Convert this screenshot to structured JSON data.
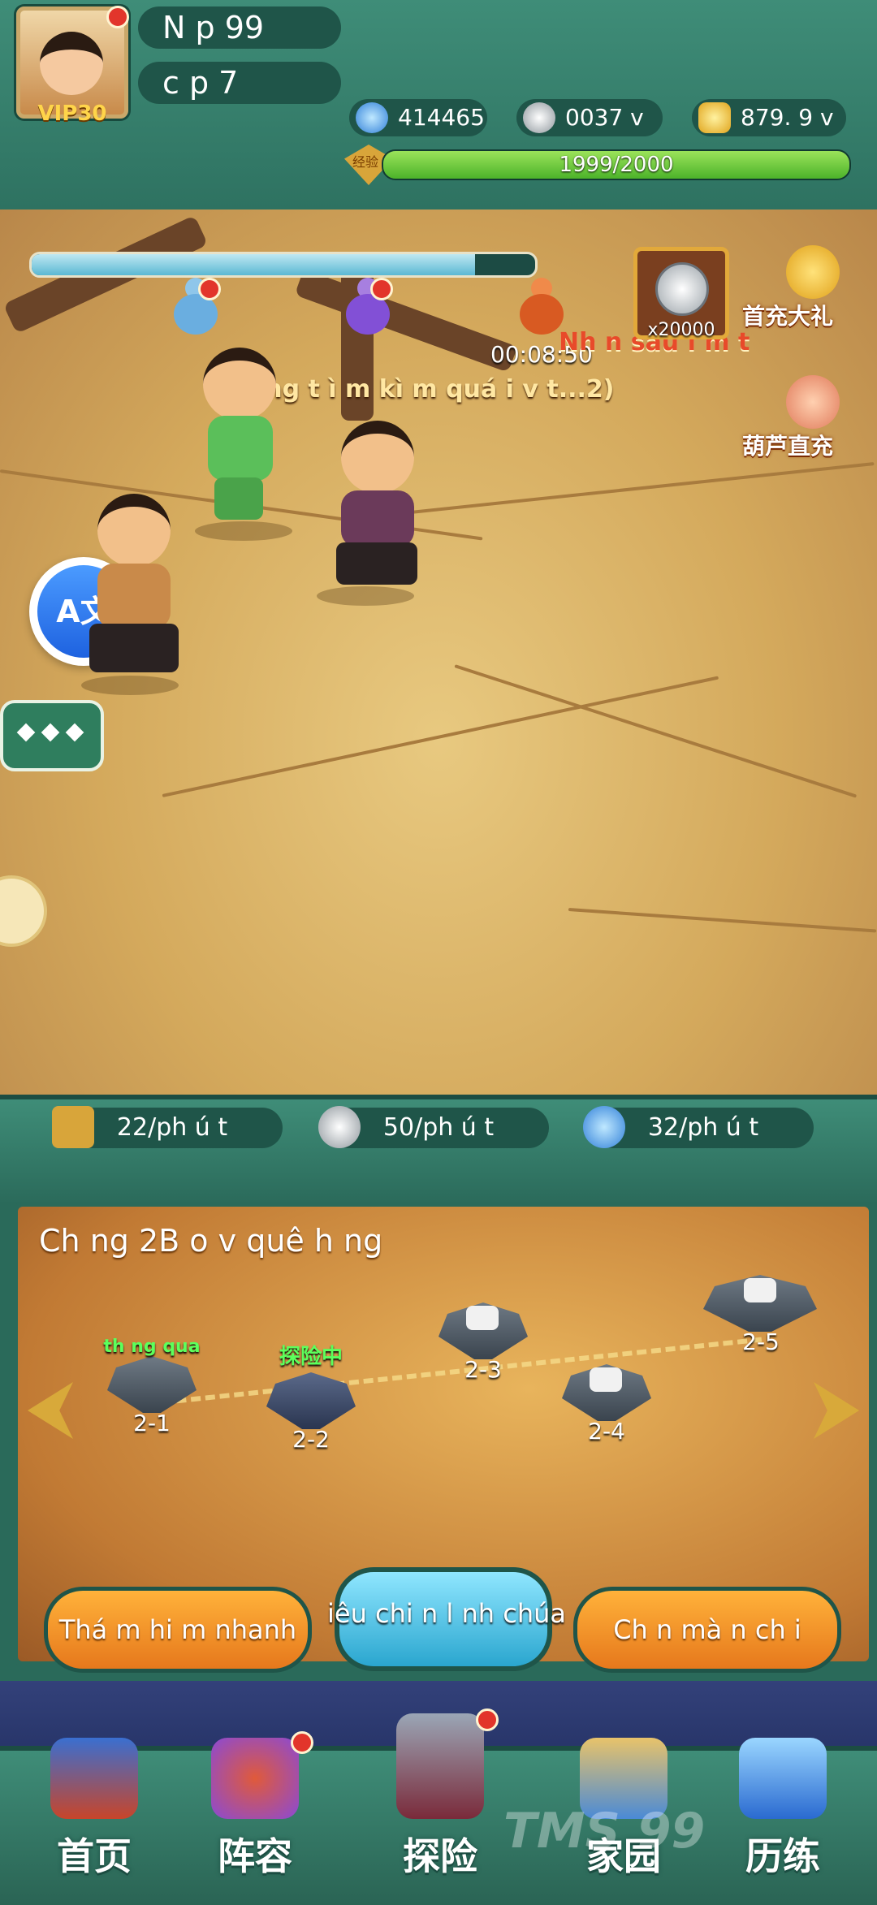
{
  "player": {
    "vip": "VIP30",
    "name": "N   p 99",
    "level": "c   p    7"
  },
  "resources": {
    "gems": "414465",
    "silver": "0037 v   n",
    "gold": "879. 9 v  n"
  },
  "exp": {
    "label": "经验",
    "text": "1999/2000",
    "fraction": 0.9995
  },
  "battle": {
    "wave_progress": 0.88,
    "timer": "00:08:50",
    "next_boss": "Nh  n sau l m  t",
    "status": "ang t ì m kì   m quá i v   t...2)",
    "reward_count": "x20000",
    "first_recharge": "首充大礼",
    "gourd_recharge": "葫芦直充",
    "translate_icon": "translate-icon"
  },
  "rates": {
    "exp": "22/ph ú t",
    "silver": "50/ph ú t",
    "gems": "32/ph ú t"
  },
  "map": {
    "chapter": "Ch        ng 2B    o  v      quê    h        ng",
    "stages": [
      {
        "num": "2-1",
        "tag": "th   ng qua"
      },
      {
        "num": "2-2",
        "tag": "探险中"
      },
      {
        "num": "2-3",
        "tag": ""
      },
      {
        "num": "2-4",
        "tag": ""
      },
      {
        "num": "2-5",
        "tag": ""
      }
    ]
  },
  "actions": {
    "quick": "Thá m hi   m nhanh",
    "boss": "iêu chi   n l    nh chúa",
    "challenge": "Ch    n mà n ch   i"
  },
  "nav": [
    {
      "label": "首页"
    },
    {
      "label": "阵容"
    },
    {
      "label": "探险"
    },
    {
      "label": "家园"
    },
    {
      "label": "历练"
    }
  ],
  "watermark": "TMS 99"
}
